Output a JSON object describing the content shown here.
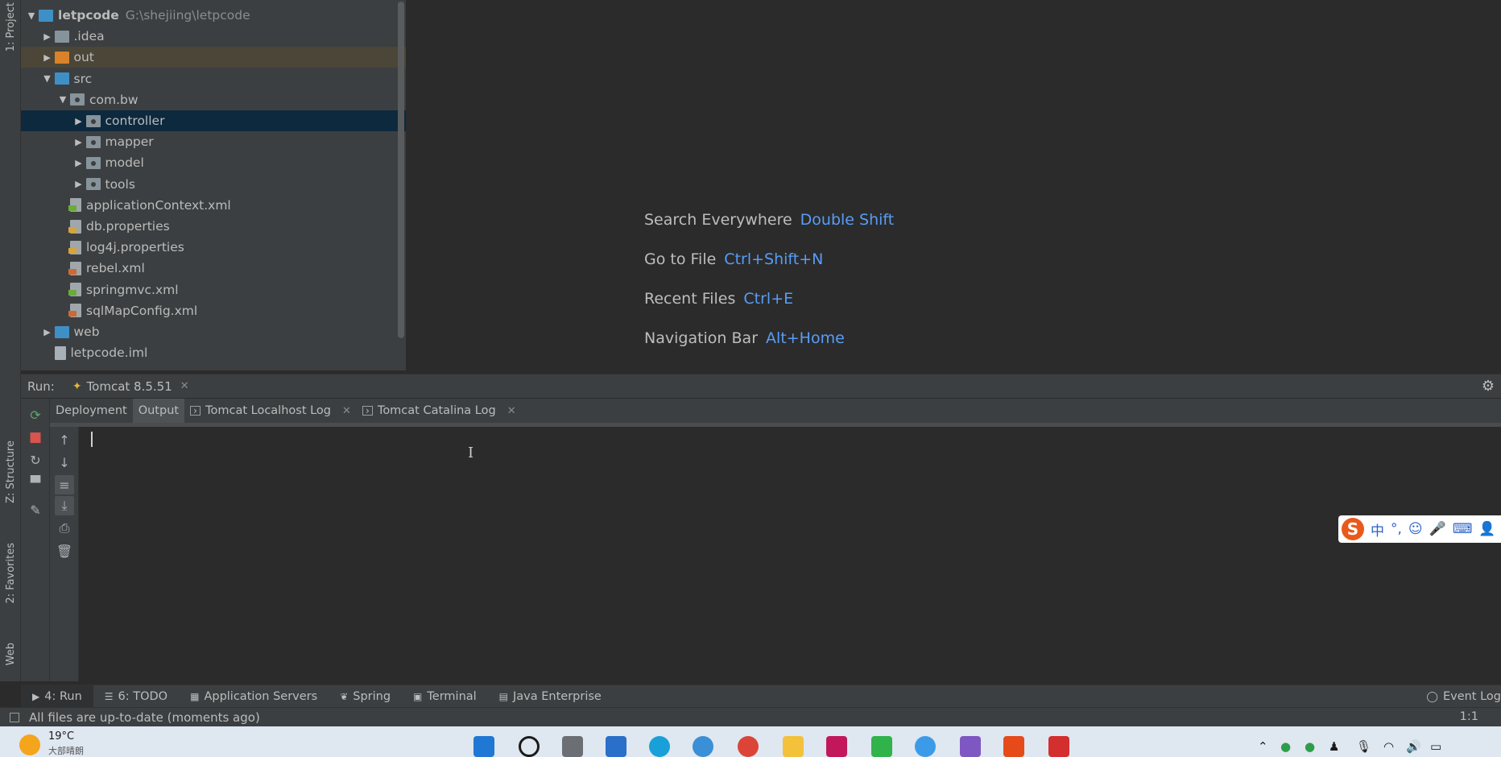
{
  "left_strip": {
    "project_tab": "1: Project",
    "structure_tab": "Z: Structure",
    "favorites_tab": "2: Favorites",
    "web_tab": "Web"
  },
  "project_tree": [
    {
      "label": "letpcode",
      "path": "G:\\shejiing\\letpcode",
      "depth": 0,
      "arrow": "▼",
      "icon": "module-folder"
    },
    {
      "label": ".idea",
      "depth": 1,
      "arrow": "▶",
      "icon": "folder"
    },
    {
      "label": "out",
      "depth": 1,
      "arrow": "▶",
      "icon": "folder-orange"
    },
    {
      "label": "src",
      "depth": 1,
      "arrow": "▼",
      "icon": "folder-blue"
    },
    {
      "label": "com.bw",
      "depth": 2,
      "arrow": "▼",
      "icon": "package"
    },
    {
      "label": "controller",
      "depth": 3,
      "arrow": "▶",
      "icon": "package"
    },
    {
      "label": "mapper",
      "depth": 3,
      "arrow": "▶",
      "icon": "package"
    },
    {
      "label": "model",
      "depth": 3,
      "arrow": "▶",
      "icon": "package"
    },
    {
      "label": "tools",
      "depth": 3,
      "arrow": "▶",
      "icon": "package"
    },
    {
      "label": "applicationContext.xml",
      "depth": 2,
      "arrow": "",
      "icon": "spring-xml"
    },
    {
      "label": "db.properties",
      "depth": 2,
      "arrow": "",
      "icon": "properties"
    },
    {
      "label": "log4j.properties",
      "depth": 2,
      "arrow": "",
      "icon": "properties"
    },
    {
      "label": "rebel.xml",
      "depth": 2,
      "arrow": "",
      "icon": "xml"
    },
    {
      "label": "springmvc.xml",
      "depth": 2,
      "arrow": "",
      "icon": "spring-xml"
    },
    {
      "label": "sqlMapConfig.xml",
      "depth": 2,
      "arrow": "",
      "icon": "xml"
    },
    {
      "label": "web",
      "depth": 1,
      "arrow": "▶",
      "icon": "folder-blue"
    },
    {
      "label": "letpcode.iml",
      "depth": 1,
      "arrow": "",
      "icon": "iml"
    }
  ],
  "editor_hints": [
    {
      "action": "Search Everywhere",
      "key": "Double Shift"
    },
    {
      "action": "Go to File",
      "key": "Ctrl+Shift+N"
    },
    {
      "action": "Recent Files",
      "key": "Ctrl+E"
    },
    {
      "action": "Navigation Bar",
      "key": "Alt+Home"
    }
  ],
  "run_window": {
    "label": "Run:",
    "config_tab": "Tomcat 8.5.51",
    "subtabs": {
      "deployment": "Deployment",
      "output": "Output",
      "localhost_log": "Tomcat Localhost Log",
      "catalina_log": "Tomcat Catalina Log"
    }
  },
  "bottom_tabs": {
    "run": "4: Run",
    "todo": "6: TODO",
    "app_servers": "Application Servers",
    "spring": "Spring",
    "terminal": "Terminal",
    "java_enterprise": "Java Enterprise",
    "event_log": "Event Log"
  },
  "status_bar": {
    "message": "All files are up-to-date (moments ago)",
    "cursor_position": "1:1"
  },
  "taskbar": {
    "temperature": "19°C",
    "weather_sub": "大部晴朗"
  },
  "ime": {
    "chinese_mode": "中"
  }
}
